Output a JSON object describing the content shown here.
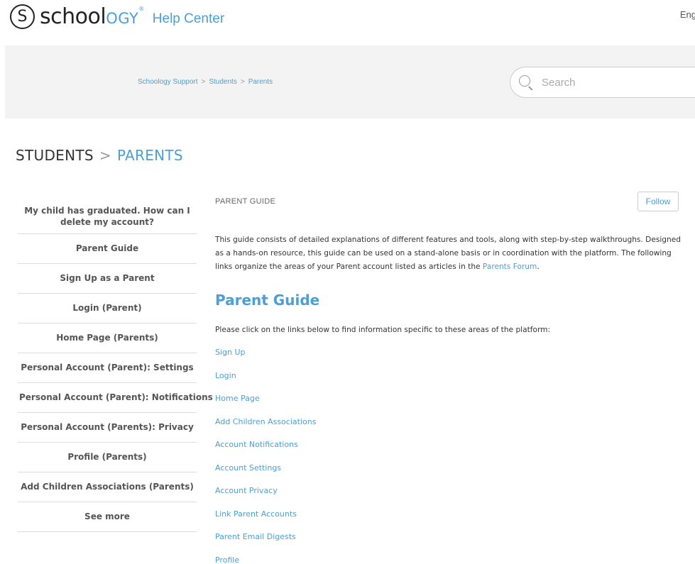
{
  "header": {
    "logo_letter": "S",
    "logo_school": "school",
    "logo_ogy": "OGY",
    "logo_tm": "®",
    "help_center": "Help Center",
    "language": "Eng"
  },
  "breadcrumb": {
    "items": [
      "Schoology Support",
      "Students",
      "Parents"
    ],
    "separator": ">"
  },
  "search": {
    "placeholder": "Search"
  },
  "page_title": {
    "parent": "STUDENTS",
    "separator": ">",
    "current": "PARENTS"
  },
  "sidebar": {
    "items": [
      "My child has graduated. How can I delete my account?",
      "Parent Guide",
      "Sign Up as a Parent",
      "Login (Parent)",
      "Home Page (Parents)",
      "Personal Account (Parent): Settings",
      "Personal Account (Parent): Notifications",
      "Personal Account (Parents): Privacy",
      "Profile (Parents)",
      "Add Children Associations (Parents)",
      "See more"
    ]
  },
  "article": {
    "section_label": "PARENT GUIDE",
    "follow_label": "Follow",
    "intro_text": "This guide consists of detailed explanations of different features and tools, along with step-by-step walkthroughs. Designed as a hands-on resource, this guide can be used on a stand-alone basis or in coordination with the platform. The following links organize the areas of your Parent account listed as articles in the ",
    "intro_link": "Parents Forum",
    "intro_end": ".",
    "title": "Parent Guide",
    "instruction": "Please click on the links below to find information specific to these areas of the platform:",
    "links": [
      "Sign Up",
      "Login",
      "Home Page",
      "Add Children Associations",
      "Account Notifications",
      "Account Settings",
      "Account Privacy",
      "Link Parent Accounts",
      "Parent Email Digests",
      "Profile"
    ]
  },
  "colors": {
    "accent": "#4a9fd6",
    "hero_bg": "#f3f3f3",
    "text": "#333333"
  }
}
